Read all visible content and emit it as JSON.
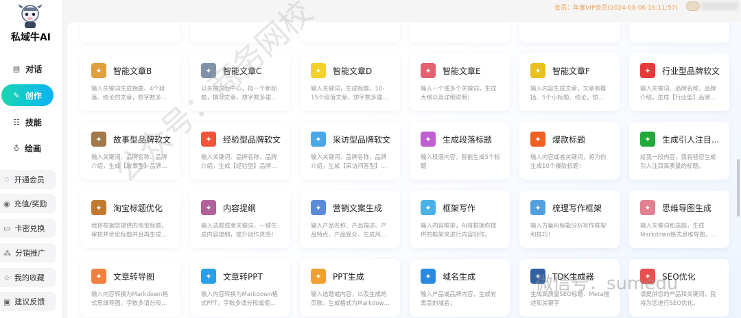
{
  "sidebar": {
    "brand": "私域牛AI",
    "nav": [
      {
        "label": "对话",
        "icon": "chat-icon"
      },
      {
        "label": "创作",
        "icon": "pen-icon",
        "active": true
      },
      {
        "label": "技能",
        "icon": "grid-icon"
      },
      {
        "label": "绘画",
        "icon": "brush-icon"
      }
    ],
    "sub": [
      {
        "label": "开通会员",
        "icon": "diamond-icon"
      },
      {
        "label": "充值/奖励",
        "icon": "coin-icon"
      },
      {
        "label": "卡密兑换",
        "icon": "card-icon"
      },
      {
        "label": "分销推广",
        "icon": "network-icon"
      },
      {
        "label": "我的收藏",
        "icon": "star-icon"
      },
      {
        "label": "建议反馈",
        "icon": "feedback-icon"
      }
    ]
  },
  "header": {
    "member": "会员：年度VIP会员(2024-08-06 16:11:57)"
  },
  "cards": [
    {
      "title": "智能文章B",
      "desc": "输入关键词生成摘要、4个段落、结论的文章，想字数多…",
      "color": "#e0a040"
    },
    {
      "title": "智能文章C",
      "desc": "以关键词为中心，拟一个新标题，撰写文章，想字数多建…",
      "color": "#8090a8"
    },
    {
      "title": "智能文章D",
      "desc": "输入关键词，生成标题，10-15个段落文章，想字数多建…",
      "color": "#f2d12a"
    },
    {
      "title": "智能文章E",
      "desc": "输入一个或多个关键词，生成大纲以及详细说明；",
      "color": "#e36070"
    },
    {
      "title": "智能文章F",
      "desc": "输入内容生成文章，文章有概括、5个小标题、结论，想…",
      "color": "#e8c020"
    },
    {
      "title": "行业型品牌软文",
      "desc": "输入关键词、品牌名称、品牌介绍，生成【行业型】品牌…",
      "color": "#e83a3a"
    },
    {
      "title": "故事型品牌软文",
      "desc": "输入关键词、品牌名称、品牌介绍，生成【故事型】品牌…",
      "color": "#a0784a"
    },
    {
      "title": "经验型品牌软文",
      "desc": "输入关键词、品牌名称、品牌介绍，生成【经验型】品牌…",
      "color": "#f0553a"
    },
    {
      "title": "采访型品牌软文",
      "desc": "输入关键词、品牌名称、品牌介绍，生成【采访问答型】…",
      "color": "#4aa8e8"
    },
    {
      "title": "生成段落标题",
      "desc": "输入段落内容，智能生成5个标题",
      "color": "#c060d0"
    },
    {
      "title": "爆款标题",
      "desc": "输入内容或者关键词，将为你生成10个爆款标题！",
      "color": "#f06020"
    },
    {
      "title": "生成引人注目...",
      "desc": "给我一段内容，我将替您生成引人注目高质量的标题。",
      "color": "#22a838"
    },
    {
      "title": "淘宝标题优化",
      "desc": "我将根据您提供的淘宝标题，审核并优化标题并且再生成…",
      "color": "#c07a30"
    },
    {
      "title": "内容提纲",
      "desc": "输入选题或者关键词，一键生成内容提纲，提升创作灵感！",
      "color": "#b0609a"
    },
    {
      "title": "营销文案生成",
      "desc": "输入产品名称、产品描述、产品特点、产品受众、生成风…",
      "color": "#5a8ad8"
    },
    {
      "title": "框架写作",
      "desc": "输入内容框架，AI将根据你提供的框架来进行内容创作。",
      "color": "#4ab0e8"
    },
    {
      "title": "梳理写作框架",
      "desc": "输入方案AI智能分析写作框架和技巧！",
      "color": "#50a0e0"
    },
    {
      "title": "思维导图生成",
      "desc": "输入关键词和选题，生成Markdown格式思维导图，…",
      "color": "#e08090"
    },
    {
      "title": "文章转导图",
      "desc": "输入内容转换为Markdown格式思维导图，字数多请分段…",
      "color": "#f08040"
    },
    {
      "title": "文章转PPT",
      "desc": "输入内容转换为Markdown格式PPT，字数多请分段或使…",
      "color": "#28a0e8"
    },
    {
      "title": "PPT生成",
      "desc": "输入选题或内容，以及生成的页数，生成格式为Markdow…",
      "color": "#f0a030"
    },
    {
      "title": "域名生成",
      "desc": "输入产品或品牌内容，生成有寓意的域名；",
      "color": "#2a8ae0"
    },
    {
      "title": "TDK生成器",
      "desc": "生成高质量SEO标题、Meta描述和关键字",
      "color": "#3060a0"
    },
    {
      "title": "SEO优化",
      "desc": "请提供您的产品和关键词，我将为您进行SEO优化。",
      "color": "#e85050"
    }
  ],
  "watermarks": {
    "diagonal": "公众号：商务网校",
    "wechat": "微信号：sumedu"
  }
}
